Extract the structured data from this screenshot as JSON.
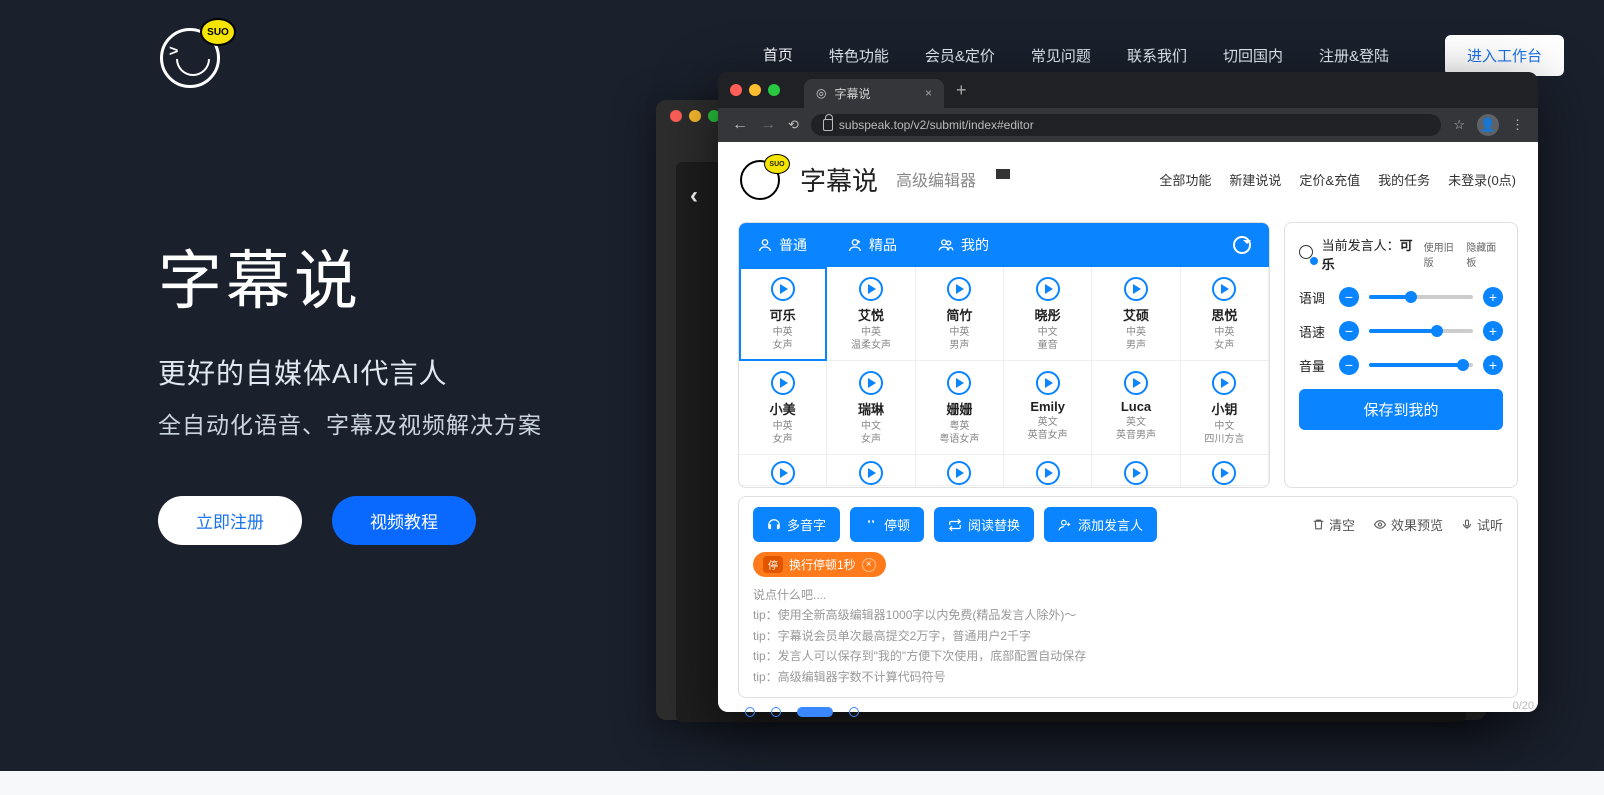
{
  "nav": {
    "links": [
      "首页",
      "特色功能",
      "会员&定价",
      "常见问题",
      "联系我们",
      "切回国内",
      "注册&登陆"
    ],
    "cta": "进入工作台",
    "logo_bubble": "SUO"
  },
  "hero": {
    "title": "字幕说",
    "sub": "更好的自媒体AI代言人",
    "sub2": "全自动化语音、字幕及视频解决方案",
    "btn_register": "立即注册",
    "btn_video": "视频教程"
  },
  "browser": {
    "tab_title": "字幕说",
    "url": "subspeak.top/v2/submit/index#editor"
  },
  "app": {
    "title": "字幕说",
    "subtitle": "高级编辑器",
    "nav": [
      "全部功能",
      "新建说说",
      "定价&充值",
      "我的任务",
      "未登录(0点)"
    ],
    "voice_tabs": [
      "普通",
      "精品",
      "我的"
    ],
    "voices": [
      {
        "name": "可乐",
        "meta1": "中英",
        "meta2": "女声"
      },
      {
        "name": "艾悦",
        "meta1": "中英",
        "meta2": "温柔女声"
      },
      {
        "name": "简竹",
        "meta1": "中英",
        "meta2": "男声"
      },
      {
        "name": "晓彤",
        "meta1": "中文",
        "meta2": "童音"
      },
      {
        "name": "艾硕",
        "meta1": "中英",
        "meta2": "男声"
      },
      {
        "name": "思悦",
        "meta1": "中英",
        "meta2": "女声"
      },
      {
        "name": "小美",
        "meta1": "中英",
        "meta2": "女声"
      },
      {
        "name": "瑞琳",
        "meta1": "中文",
        "meta2": "女声"
      },
      {
        "name": "姗姗",
        "meta1": "粤英",
        "meta2": "粤语女声"
      },
      {
        "name": "Emily",
        "meta1": "英文",
        "meta2": "英音女声"
      },
      {
        "name": "Luca",
        "meta1": "英文",
        "meta2": "英音男声"
      },
      {
        "name": "小钥",
        "meta1": "中文",
        "meta2": "四川方言"
      }
    ],
    "control": {
      "label_prefix": "当前发言人：",
      "speaker": "可乐",
      "toggle_old": "使用旧版",
      "toggle_hide": "隐藏面板",
      "slider_pitch": "语调",
      "slider_rate": "语速",
      "slider_vol": "音量",
      "save": "保存到我的",
      "pitch_pct": 40,
      "rate_pct": 65,
      "vol_pct": 90
    },
    "editor": {
      "btn_polyphone": "多音字",
      "btn_pause": "停顿",
      "btn_replace": "阅读替换",
      "btn_addspeaker": "添加发言人",
      "btn_clear": "清空",
      "btn_preview": "效果预览",
      "btn_listen": "试听",
      "chip_badge": "停",
      "chip_text": "换行停顿1秒",
      "placeholder": "说点什么吧....",
      "tips": [
        "tip：使用全新高级编辑器1000字以内免费(精品发言人除外)～",
        "tip：字幕说会员单次最高提交2万字，普通用户2千字",
        "tip：发言人可以保存到\"我的\"方便下次使用，底部配置自动保存",
        "tip：高级编辑器字数不计算代码符号"
      ],
      "counter": "0/20"
    }
  }
}
